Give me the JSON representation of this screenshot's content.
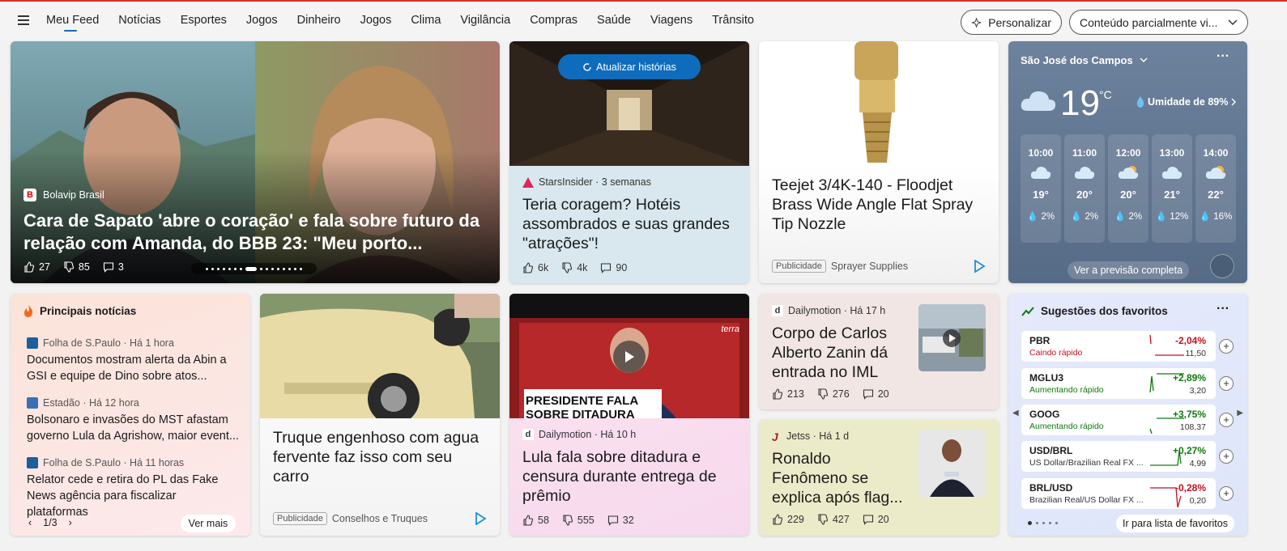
{
  "nav": {
    "items": [
      "Meu Feed",
      "Notícias",
      "Esportes",
      "Jogos",
      "Dinheiro",
      "Jogos",
      "Clima",
      "Vigilância",
      "Compras",
      "Saúde",
      "Viagens",
      "Trânsito"
    ],
    "personalize_label": "Personalizar",
    "content_select_value": "Conteúdo parcialmente vi..."
  },
  "hero": {
    "source": "Bolavip Brasil",
    "headline": "Cara de Sapato 'abre o coração' e fala sobre futuro da relação com Amanda, do BBB 23: \"Meu porto...",
    "likes": "27",
    "dislikes": "85",
    "comments": "3"
  },
  "hotel_card": {
    "refresh_label": "Atualizar histórias",
    "source": "StarsInsider · 3 semanas",
    "headline": "Teria coragem? Hotéis assombrados e suas grandes \"atrações\"!",
    "likes": "6k",
    "dislikes": "4k",
    "comments": "90"
  },
  "nozzle_ad": {
    "headline": "Teejet 3/4K-140 - Floodjet Brass Wide Angle Flat Spray Tip Nozzle",
    "badge": "Publicidade",
    "sponsor": "Sprayer Supplies"
  },
  "weather": {
    "city": "São José dos Campos",
    "temp": "19",
    "unit": "°C",
    "humidity": "Umidade de 89%",
    "forecast_link": "Ver a previsão completa",
    "hours": [
      {
        "time": "10:00",
        "temp": "19°",
        "precip": "2%"
      },
      {
        "time": "11:00",
        "temp": "20°",
        "precip": "2%"
      },
      {
        "time": "12:00",
        "temp": "20°",
        "precip": "2%"
      },
      {
        "time": "13:00",
        "temp": "21°",
        "precip": "12%"
      },
      {
        "time": "14:00",
        "temp": "22°",
        "precip": "16%"
      }
    ]
  },
  "top_news": {
    "title": "Principais notícias",
    "items": [
      {
        "source": "Folha de S.Paulo · Há 1 hora",
        "headline": "Documentos mostram alerta da Abin a GSI e equipe de Dino sobre atos..."
      },
      {
        "source": "Estadão · Há 12 hora",
        "headline": "Bolsonaro e invasões do MST afastam governo Lula da Agrishow, maior event..."
      },
      {
        "source": "Folha de S.Paulo · Há 11 horas",
        "headline": "Relator cede e retira do PL das Fake News agência para fiscalizar plataformas"
      }
    ],
    "pager": "1/3",
    "more_label": "Ver mais"
  },
  "car_ad": {
    "headline": "Truque engenhoso com agua fervente faz isso com seu carro",
    "badge": "Publicidade",
    "sponsor": "Conselhos e Truques"
  },
  "lula_card": {
    "overlay_text": "PRESIDENTE FALA SOBRE DITADURA",
    "watermark": "terra",
    "source": "Dailymotion · Há 10 h",
    "headline": "Lula fala sobre ditadura e censura durante entrega de prêmio",
    "likes": "58",
    "dislikes": "555",
    "comments": "32"
  },
  "zanin_card": {
    "source": "Dailymotion · Há 17 h",
    "headline": "Corpo de Carlos Alberto Zanin dá entrada no IML",
    "likes": "213",
    "dislikes": "276",
    "comments": "20"
  },
  "ronaldo_card": {
    "source": "Jetss · Há 1 d",
    "headline": "Ronaldo Fenômeno se explica após flag...",
    "likes": "229",
    "dislikes": "427",
    "comments": "20"
  },
  "watchlist": {
    "title": "Sugestões dos favoritos",
    "link": "Ir para lista de favoritos",
    "stocks": [
      {
        "symbol": "PBR",
        "sub": "Caindo rápido",
        "change": "-2,04%",
        "value": "11,50",
        "color": "#c50f1f"
      },
      {
        "symbol": "MGLU3",
        "sub": "Aumentando rápido",
        "change": "+2,89%",
        "value": "3,20",
        "color": "#0e7a0d"
      },
      {
        "symbol": "GOOG",
        "sub": "Aumentando rápido",
        "change": "+3,75%",
        "value": "108,37",
        "color": "#0e7a0d"
      },
      {
        "symbol": "USD/BRL",
        "sub": "US Dollar/Brazilian Real FX ...",
        "change": "+0,27%",
        "value": "4,99",
        "color": "#0e7a0d"
      },
      {
        "symbol": "BRL/USD",
        "sub": "Brazilian Real/US Dollar FX ...",
        "change": "-0,28%",
        "value": "0,20",
        "color": "#c50f1f"
      }
    ]
  }
}
